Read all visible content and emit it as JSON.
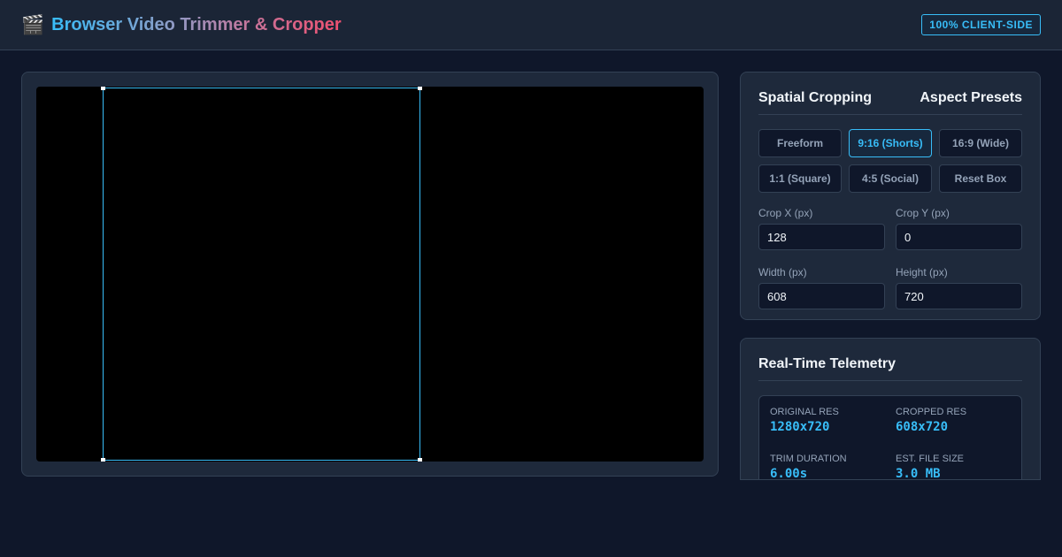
{
  "header": {
    "icon": "clapper-board-icon",
    "title": "Browser Video Trimmer & Cropper",
    "badge": "100% CLIENT-SIDE"
  },
  "colors": {
    "accent": "#38bdf8",
    "background": "#0f172a",
    "panel": "#1e293b",
    "border": "#334155",
    "title_gradient_end": "#ef4f6f"
  },
  "crop_panel": {
    "title": "Spatial Cropping",
    "subtitle": "Aspect Presets",
    "presets": [
      {
        "label": "Freeform",
        "active": false
      },
      {
        "label": "9:16 (Shorts)",
        "active": true
      },
      {
        "label": "16:9 (Wide)",
        "active": false
      },
      {
        "label": "1:1 (Square)",
        "active": false
      },
      {
        "label": "4:5 (Social)",
        "active": false
      },
      {
        "label": "Reset Box",
        "active": false
      }
    ],
    "fields": {
      "crop_x": {
        "label": "Crop X (px)",
        "value": "128"
      },
      "crop_y": {
        "label": "Crop Y (px)",
        "value": "0"
      },
      "width": {
        "label": "Width (px)",
        "value": "608"
      },
      "height": {
        "label": "Height (px)",
        "value": "720"
      }
    }
  },
  "telemetry": {
    "title": "Real-Time Telemetry",
    "stats": {
      "original_res": {
        "label": "ORIGINAL RES",
        "value": "1280x720"
      },
      "cropped_res": {
        "label": "CROPPED RES",
        "value": "608x720"
      },
      "trim_duration": {
        "label": "TRIM DURATION",
        "value": "6.00s"
      },
      "est_file_size": {
        "label": "EST. FILE SIZE",
        "value": "3.0 MB"
      }
    }
  }
}
